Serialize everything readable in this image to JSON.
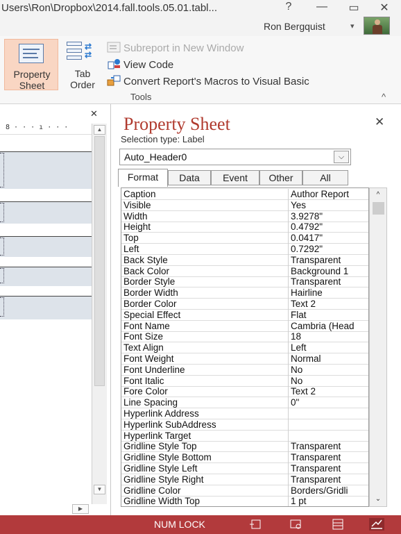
{
  "window": {
    "title": "Users\\Ron\\Dropbox\\2014.fall.tools.05.01.tabl...",
    "help": "?",
    "minimize": "—",
    "restore": "▭",
    "close": "✕",
    "user": "Ron Bergquist",
    "user_dropdown": "▾"
  },
  "ribbon": {
    "property_sheet_line1": "Property",
    "property_sheet_line2": "Sheet",
    "tab_order_line1": "Tab",
    "tab_order_line2": "Order",
    "subreport": "Subreport in New Window",
    "view_code": "View Code",
    "convert_macros": "Convert Report's Macros to Visual Basic",
    "group_label": "Tools",
    "collapse": "^"
  },
  "left_pane": {
    "close": "✕",
    "ruler": "8 · · · ı · · ·",
    "scroll_up": "▲",
    "scroll_down": "▼",
    "scroll_right": "▶"
  },
  "property_sheet": {
    "title": "Property Sheet",
    "close": "✕",
    "selection_type": "Selection type:  Label",
    "selected_object": "Auto_Header0",
    "dropdown_arrow": "⌵",
    "tabs": [
      "Format",
      "Data",
      "Event",
      "Other",
      "All"
    ],
    "active_tab": "Format",
    "scroll_up": "^",
    "scroll_down": "⌄",
    "properties": [
      {
        "name": "Caption",
        "value": "Author Report"
      },
      {
        "name": "Visible",
        "value": "Yes"
      },
      {
        "name": "Width",
        "value": "3.9278\""
      },
      {
        "name": "Height",
        "value": "0.4792\""
      },
      {
        "name": "Top",
        "value": "0.0417\""
      },
      {
        "name": "Left",
        "value": "0.7292\""
      },
      {
        "name": "Back Style",
        "value": "Transparent"
      },
      {
        "name": "Back Color",
        "value": "Background 1"
      },
      {
        "name": "Border Style",
        "value": "Transparent"
      },
      {
        "name": "Border Width",
        "value": "Hairline"
      },
      {
        "name": "Border Color",
        "value": "Text 2"
      },
      {
        "name": "Special Effect",
        "value": "Flat"
      },
      {
        "name": "Font Name",
        "value": "Cambria (Head"
      },
      {
        "name": "Font Size",
        "value": "18"
      },
      {
        "name": "Text Align",
        "value": "Left"
      },
      {
        "name": "Font Weight",
        "value": "Normal"
      },
      {
        "name": "Font Underline",
        "value": "No"
      },
      {
        "name": "Font Italic",
        "value": "No"
      },
      {
        "name": "Fore Color",
        "value": "Text 2"
      },
      {
        "name": "Line Spacing",
        "value": "0\""
      },
      {
        "name": "Hyperlink Address",
        "value": ""
      },
      {
        "name": "Hyperlink SubAddress",
        "value": ""
      },
      {
        "name": "Hyperlink Target",
        "value": ""
      },
      {
        "name": "Gridline Style Top",
        "value": "Transparent"
      },
      {
        "name": "Gridline Style Bottom",
        "value": "Transparent"
      },
      {
        "name": "Gridline Style Left",
        "value": "Transparent"
      },
      {
        "name": "Gridline Style Right",
        "value": "Transparent"
      },
      {
        "name": "Gridline Color",
        "value": "Borders/Gridli"
      },
      {
        "name": "Gridline Width Top",
        "value": "1 pt"
      }
    ]
  },
  "status_bar": {
    "num_lock": "NUM LOCK"
  },
  "colors": {
    "accent": "#b03a2e",
    "status_bar": "#b23a3c",
    "ribbon_selected": "#f9d6c3"
  }
}
